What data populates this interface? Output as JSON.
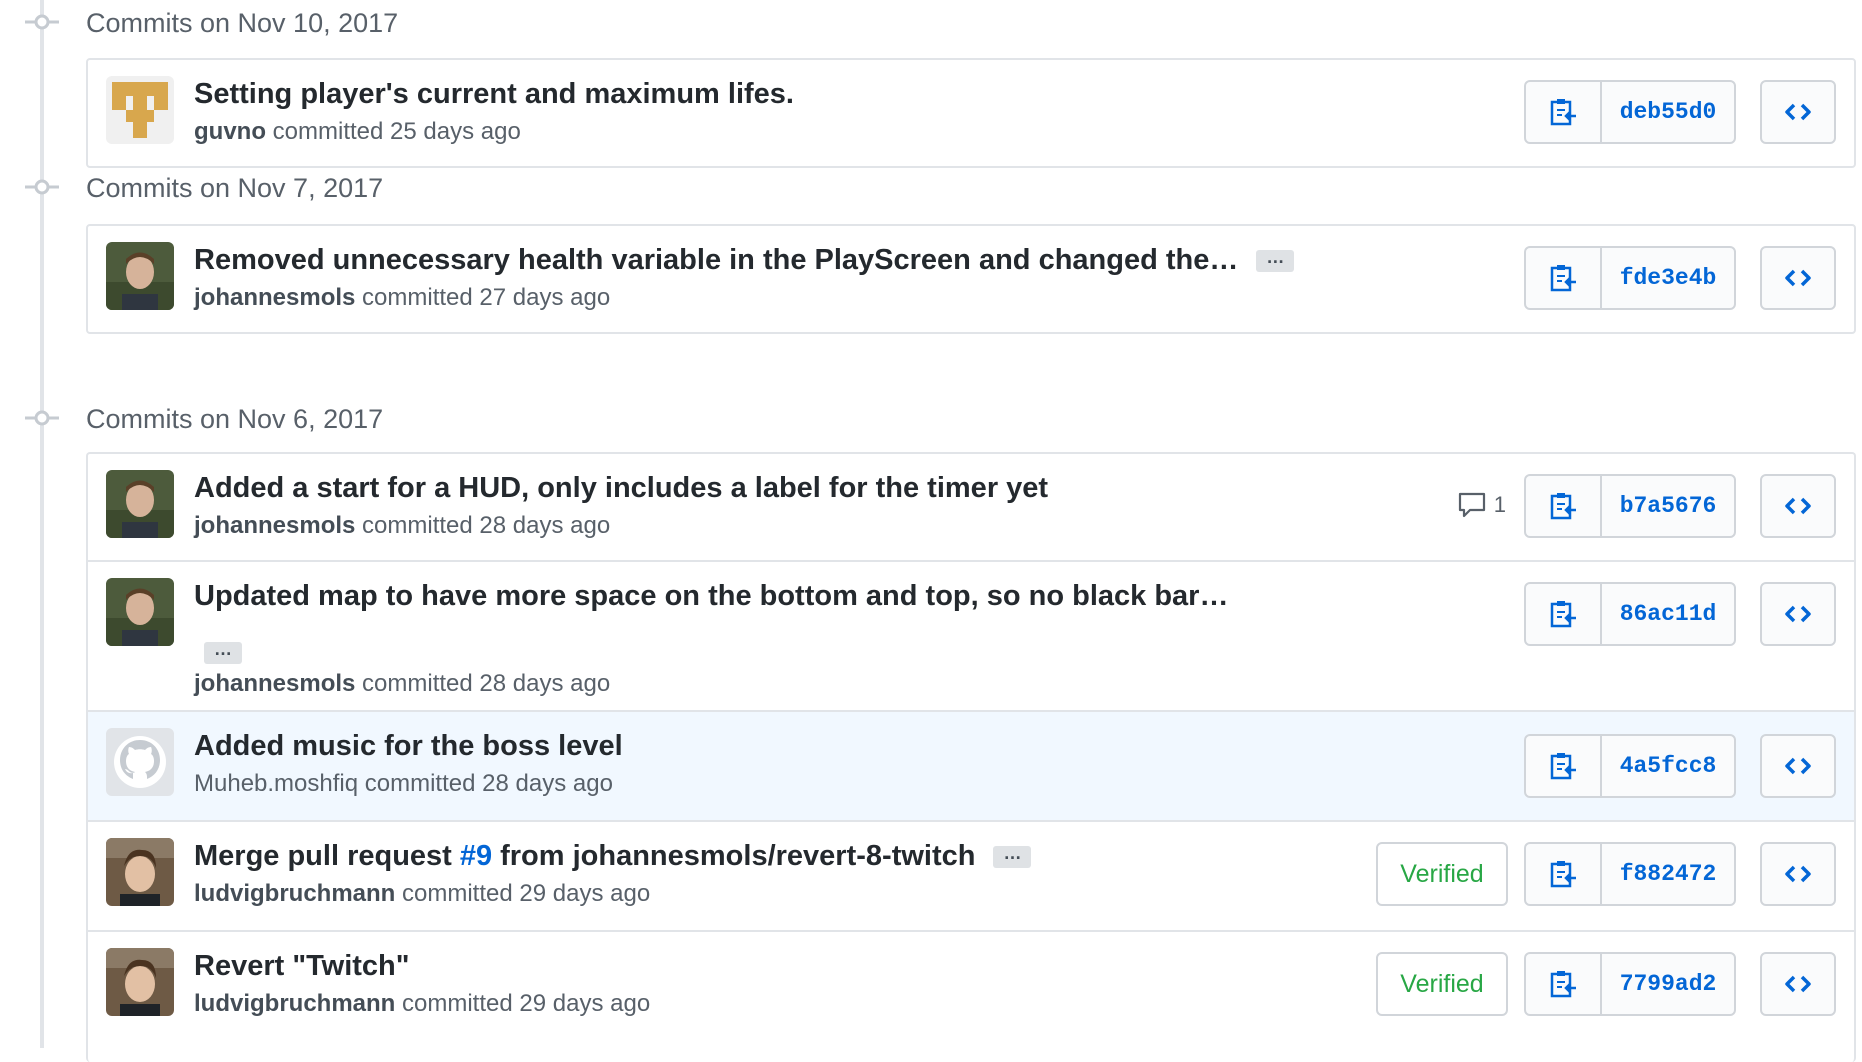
{
  "groups": [
    {
      "title": "Commits on Nov 10, 2017",
      "commits": [
        {
          "title": "Setting player's current and maximum lifes.",
          "author": "guvno",
          "verb": "committed",
          "time": "25 days ago",
          "sha": "deb55d0"
        }
      ]
    },
    {
      "title": "Commits on Nov 7, 2017",
      "commits": [
        {
          "title": "Removed unnecessary health variable in the PlayScreen and changed the…",
          "ellipsis": "…",
          "author": "johannesmols",
          "verb": "committed",
          "time": "27 days ago",
          "sha": "fde3e4b"
        }
      ]
    },
    {
      "title": "Commits on Nov 6, 2017",
      "commits": [
        {
          "title": "Added a start for a HUD, only includes a label for the timer yet",
          "author": "johannesmols",
          "verb": "committed",
          "time": "28 days ago",
          "comments": "1",
          "sha": "b7a5676"
        },
        {
          "title": "Updated map to have more space on the bottom and top, so no black bar…",
          "ellipsis": "…",
          "author": "johannesmols",
          "verb": "committed",
          "time": "28 days ago",
          "sha": "86ac11d"
        },
        {
          "title": "Added music for the boss level",
          "author": "Muheb.moshfiq",
          "verb": "committed",
          "time": "28 days ago",
          "sha": "4a5fcc8"
        },
        {
          "title_prefix": "Merge pull request",
          "title_link": "#9",
          "title_suffix": "from johannesmols/revert-8-twitch",
          "ellipsis": "…",
          "author": "ludvigbruchmann",
          "verb": "committed",
          "time": "29 days ago",
          "verified": "Verified",
          "sha": "f882472"
        },
        {
          "title": "Revert \"Twitch\"",
          "author": "ludvigbruchmann",
          "verb": "committed",
          "time": "29 days ago",
          "verified": "Verified",
          "sha": "7799ad2"
        }
      ]
    }
  ],
  "colors": {
    "link": "#0366d6",
    "verified": "#28a745",
    "highlight_row": "#f1f8ff",
    "border": "#e1e4e8",
    "identicon": "#d8a74d"
  },
  "icons": {
    "timeline_node": "git-commit-icon",
    "copy": "clipboard-icon",
    "browse": "code-icon",
    "comment": "comment-icon"
  }
}
